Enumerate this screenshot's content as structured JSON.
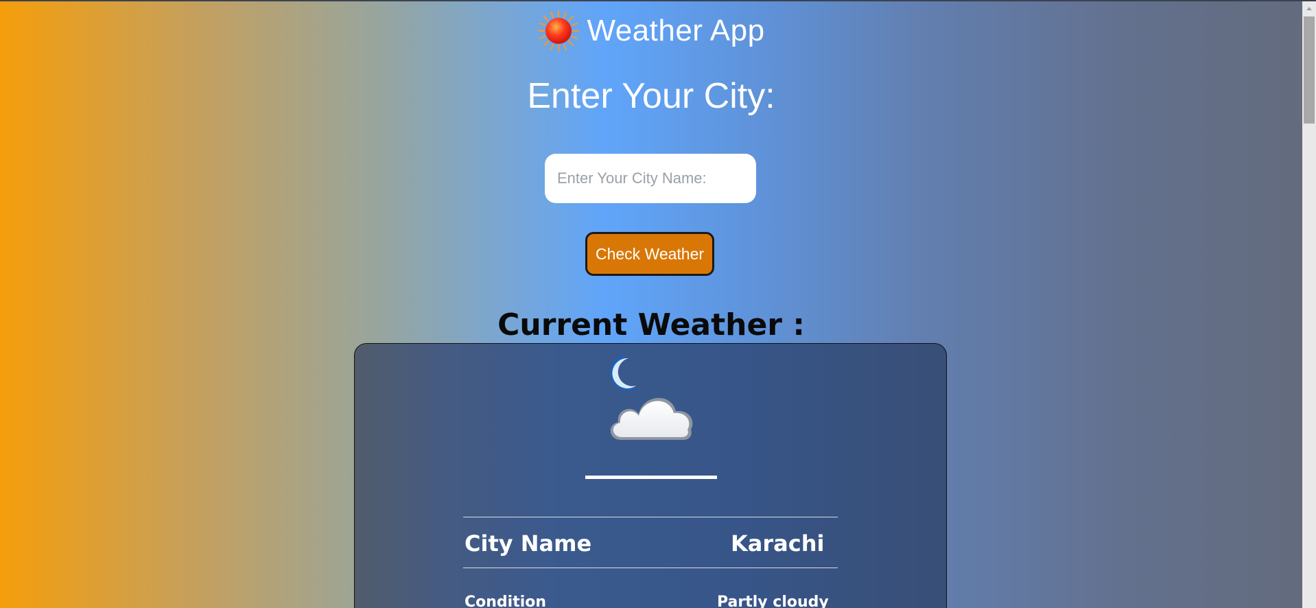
{
  "header": {
    "title": "Weather App",
    "logo_icon": "sun-icon"
  },
  "search": {
    "heading": "Enter Your City:",
    "placeholder": "Enter Your City Name:",
    "value": "",
    "button_label": "Check Weather"
  },
  "current": {
    "heading": "Current Weather :",
    "icon": "partly-cloudy-night-icon",
    "temperature": "",
    "rows": [
      {
        "label": "City Name",
        "value": "Karachi"
      },
      {
        "label": "Condition",
        "value": "Partly cloudy"
      }
    ]
  },
  "colors": {
    "button": "#d97706",
    "gradient_left": "#f59e0b",
    "gradient_mid": "#60a5fa",
    "gradient_right": "#636b7c"
  }
}
